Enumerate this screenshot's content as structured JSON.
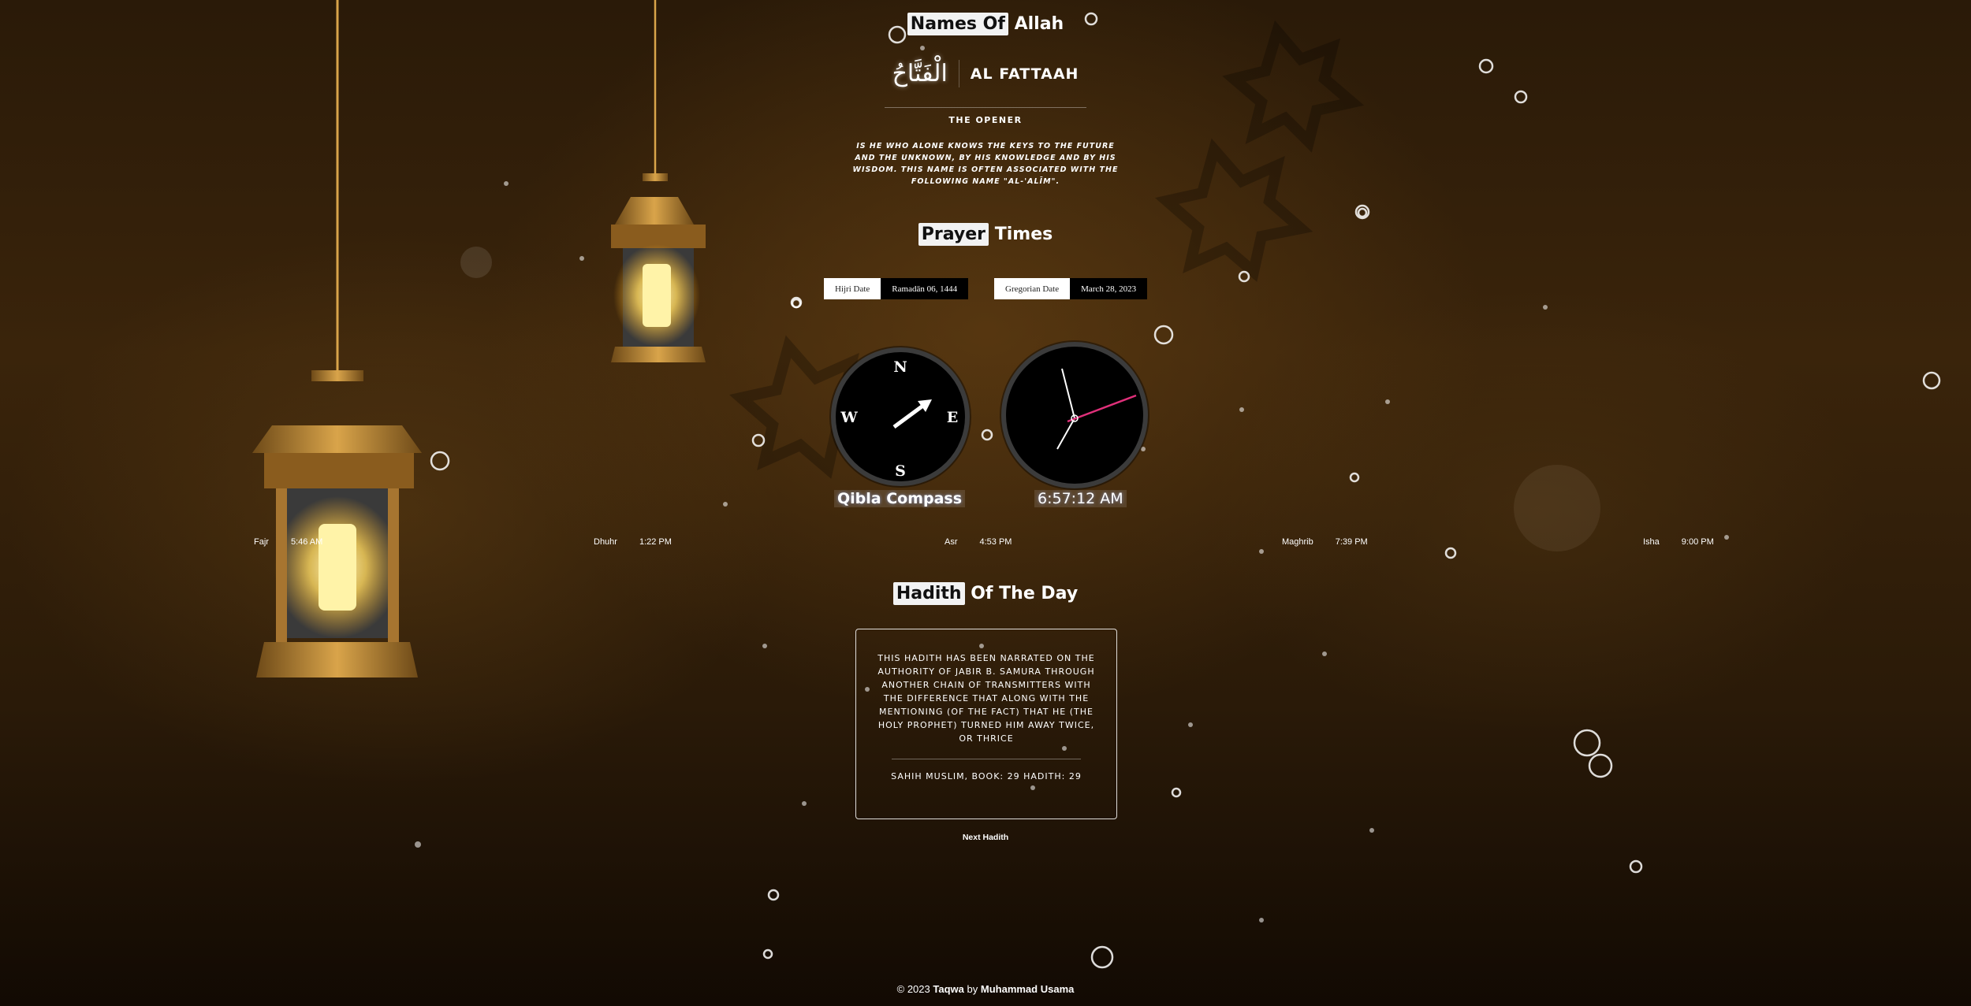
{
  "names": {
    "title_highlight": "Names Of",
    "title_rest": "Allah",
    "arabic": "الْفَتَّاحُ",
    "transliteration": "AL FATTAAH",
    "meaning": "THE OPENER",
    "description": "IS HE WHO ALONE KNOWS THE KEYS TO THE FUTURE AND THE UNKNOWN, BY HIS KNOWLEDGE AND BY HIS WISDOM. THIS NAME IS OFTEN ASSOCIATED WITH THE FOLLOWING NAME \"AL-'ALĪM\"."
  },
  "prayer": {
    "title_highlight": "Prayer",
    "title_rest": "Times",
    "hijri_label": "Hijri Date",
    "hijri_value": "Ramadān 06, 1444",
    "gregorian_label": "Gregorian Date",
    "gregorian_value": "March 28, 2023",
    "compass": {
      "n": "N",
      "e": "E",
      "s": "S",
      "w": "W",
      "label": "Qibla Compass"
    },
    "clock_label": "6:57:12 AM",
    "times": [
      {
        "name": "Fajr",
        "time": "5:46 AM"
      },
      {
        "name": "Dhuhr",
        "time": "1:22 PM"
      },
      {
        "name": "Asr",
        "time": "4:53 PM"
      },
      {
        "name": "Maghrib",
        "time": "7:39 PM"
      },
      {
        "name": "Isha",
        "time": "9:00 PM"
      }
    ]
  },
  "hadith": {
    "title_highlight": "Hadith",
    "title_rest": "Of The Day",
    "text": "THIS HADITH HAS BEEN NARRATED ON THE AUTHORITY OF JABIR B. SAMURA THROUGH ANOTHER CHAIN OF TRANSMITTERS WITH THE DIFFERENCE THAT ALONG WITH THE MENTIONING (OF THE FACT) THAT HE (THE HOLY PROPHET) TURNED HIM AWAY TWICE, OR THRICE",
    "reference": "SAHIH MUSLIM, BOOK: 29 HADITH: 29",
    "next_label": "Next Hadith"
  },
  "footer": {
    "prefix": "© 2023",
    "brand": "Taqwa",
    "by": "by",
    "author": "Muhammad Usama"
  },
  "colors": {
    "background": "#2a1a08",
    "clock_second_hand": "#e0307a",
    "highlight": "#f2f2f2"
  }
}
